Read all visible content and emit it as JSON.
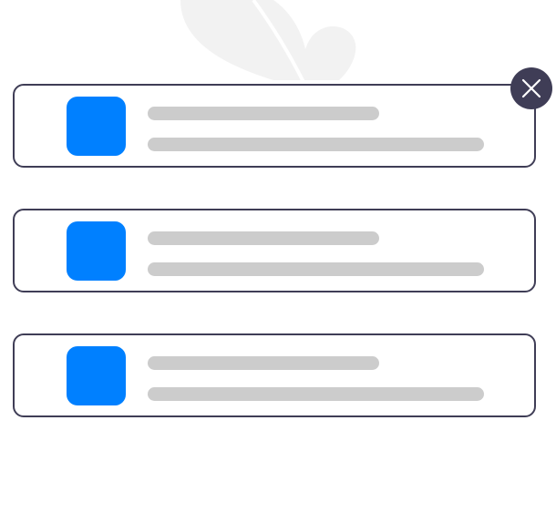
{
  "colors": {
    "background": "#ffffff",
    "leaf": "#f2f2f2",
    "leaf_stroke": "#ffffff",
    "card_border": "#3f3d56",
    "thumbnail": "#0080ff",
    "placeholder_line": "#cccccc",
    "close_button_bg": "#3f3d56",
    "close_icon": "#ffffff"
  },
  "close_button": {
    "icon": "close-icon"
  },
  "cards": [
    {
      "thumbnail_icon": "image-placeholder",
      "lines": 2
    },
    {
      "thumbnail_icon": "image-placeholder",
      "lines": 2
    },
    {
      "thumbnail_icon": "image-placeholder",
      "lines": 2
    }
  ]
}
